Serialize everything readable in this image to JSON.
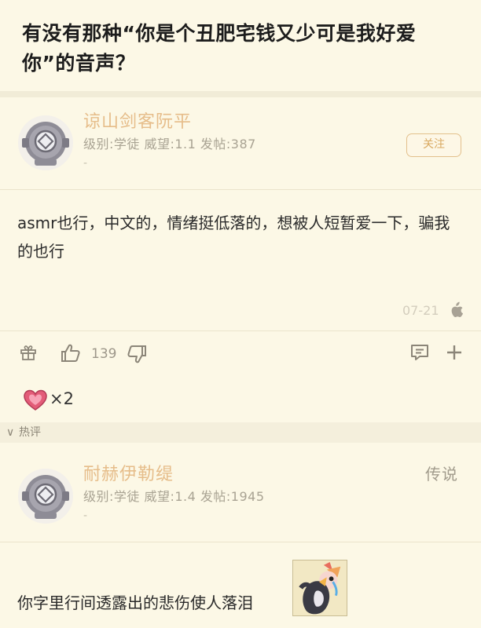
{
  "post": {
    "title": "有没有那种“你是个丑肥宅钱又少可是我好爱你”的音声？"
  },
  "main_comment": {
    "username": "谅山剑客阮平",
    "meta": "级别:学徒 威望:1.1 发帖:387",
    "meta_extra": "-",
    "follow_label": "关注",
    "content": "asmr也行，中文的，情绪挺低落的，想被人短暂爱一下，骗我的也行",
    "date": "07-21",
    "like_count": "139",
    "reaction_count": "×2"
  },
  "hot_section": {
    "label": "热评",
    "chevron": "∨"
  },
  "reply": {
    "username": "耐赫伊勒缇",
    "meta": "级别:学徒 威望:1.4 发帖:1945",
    "meta_extra": "-",
    "rank": "传说",
    "content": "你字里行间透露出的悲伤使人落泪"
  },
  "icons": {
    "avatar": "diving-helmet-avatar-icon",
    "gift": "gift-icon",
    "like": "thumbs-up-icon",
    "dislike": "thumbs-down-icon",
    "comment": "comment-icon",
    "more": "plus-icon",
    "platform": "apple-icon",
    "reaction": "heart-reaction-icon"
  },
  "colors": {
    "background": "#fcf8e6",
    "username": "#e6bd8a",
    "follow_border": "#e3c08c"
  }
}
